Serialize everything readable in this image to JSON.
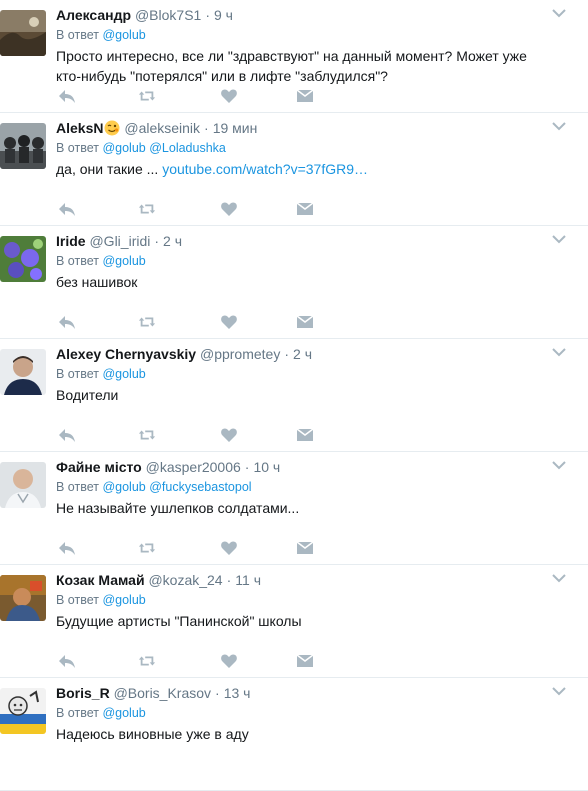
{
  "tweets": [
    {
      "fullname": "Александр",
      "username": "@Blok7S1",
      "time": "9 ч",
      "reply_label": "В ответ",
      "reply_to": [
        "@golub"
      ],
      "text": "Просто интересно, все ли \"здравствуют\" на данный момент? Может уже кто-нибудь \"потерялся\" или в лифте \"заблудился\"?",
      "link": ""
    },
    {
      "fullname": "AleksN",
      "username": "@alekseinik",
      "time": "19 мин",
      "reply_label": "В ответ",
      "reply_to": [
        "@golub",
        "@Loladushka"
      ],
      "text": "да, они такие ... ",
      "link": "youtube.com/watch?v=37fGR9…"
    },
    {
      "fullname": "Iride",
      "username": "@Gli_iridi",
      "time": "2 ч",
      "reply_label": "В ответ",
      "reply_to": [
        "@golub"
      ],
      "text": "без нашивок",
      "link": ""
    },
    {
      "fullname": "Alexey Chernyavskiy",
      "username": "@pprometey",
      "time": "2 ч",
      "reply_label": "В ответ",
      "reply_to": [
        "@golub"
      ],
      "text": "Водители",
      "link": ""
    },
    {
      "fullname": "Файне місто",
      "username": "@kasper20006",
      "time": "10 ч",
      "reply_label": "В ответ",
      "reply_to": [
        "@golub",
        "@fuckysebastopol"
      ],
      "text": "Не называйте ушлепков солдатами...",
      "link": ""
    },
    {
      "fullname": "Козак Мамай",
      "username": "@kozak_24",
      "time": "11 ч",
      "reply_label": "В ответ",
      "reply_to": [
        "@golub"
      ],
      "text": "Будущие артисты \"Панинской\" школы",
      "link": ""
    },
    {
      "fullname": "Boris_R",
      "username": "@Boris_Krasov",
      "time": "13 ч",
      "reply_label": "В ответ",
      "reply_to": [
        "@golub"
      ],
      "text": "Надеюсь виновные уже в аду",
      "link": ""
    }
  ],
  "icons": {
    "reply": "reply-icon",
    "retweet": "retweet-icon",
    "like": "heart-icon",
    "dm": "direct-message-icon",
    "caret": "chevron-down-icon",
    "emoji": "winking-face-emoji-icon"
  },
  "colors": {
    "action_icon": "#aab8c2",
    "link": "#1b95e0",
    "secondary_text": "#657786",
    "divider": "#e6ecf0"
  }
}
